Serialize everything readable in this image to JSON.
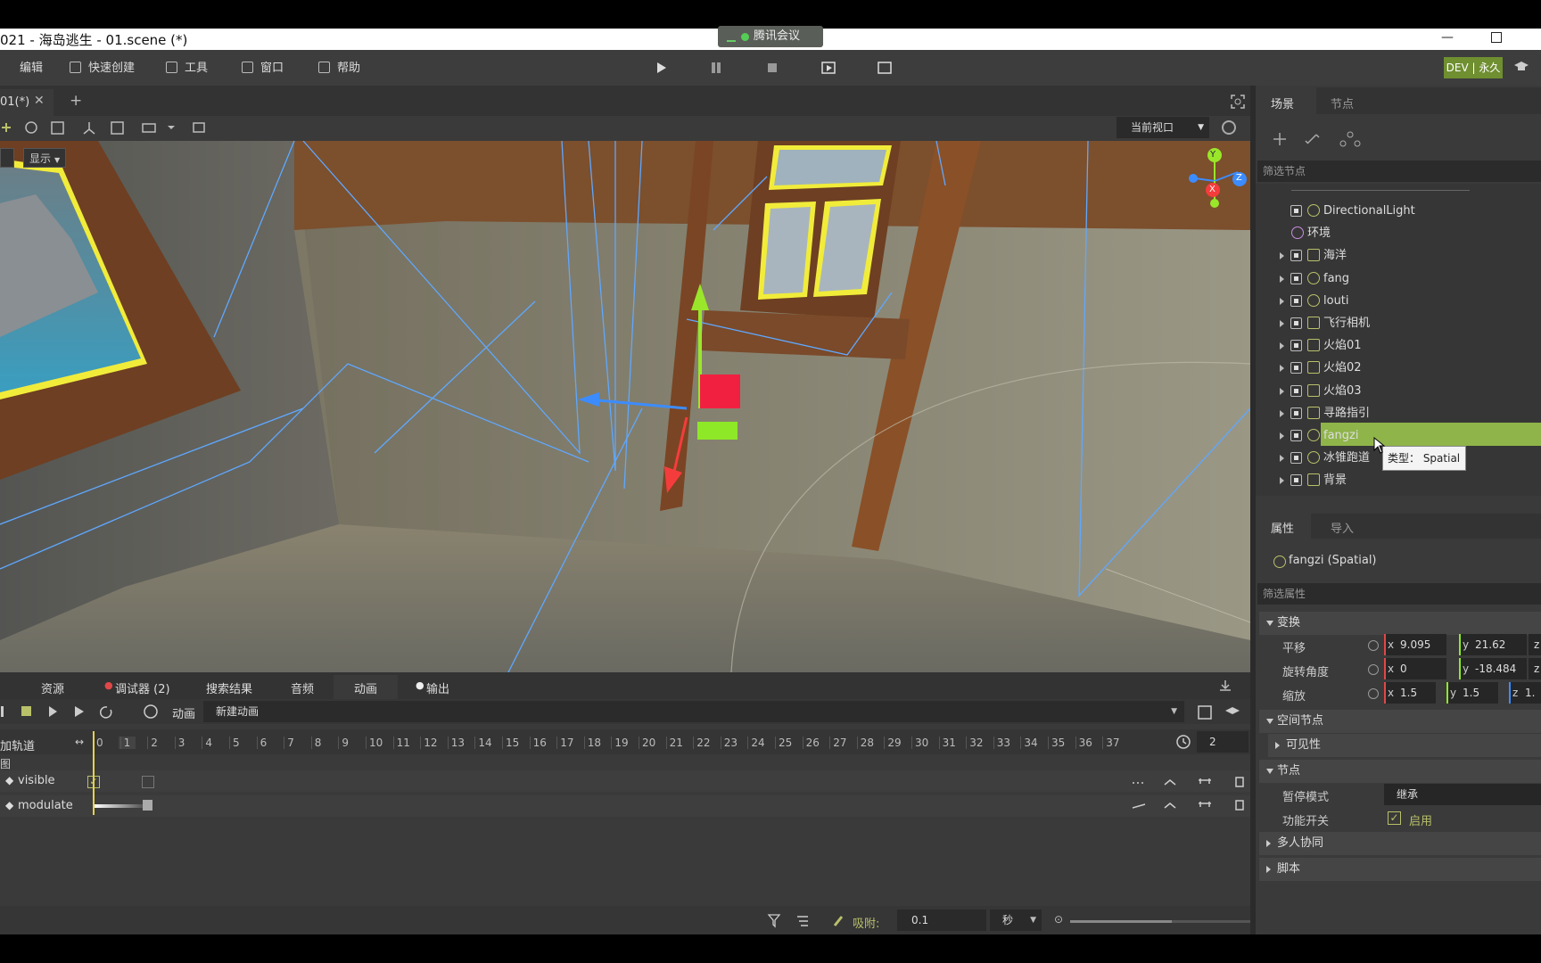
{
  "window": {
    "title": "021 - 海岛逃生 - 01.scene (*)",
    "meeting_label": "腾讯会议",
    "minimize": "—"
  },
  "menu": {
    "items": [
      "编辑",
      "快速创建",
      "工具",
      "窗口",
      "帮助"
    ],
    "badge": "DEV | 永久"
  },
  "editor": {
    "tab": "01(*)",
    "add_tab": "+",
    "show_menu": "显示",
    "viewport_select": "当前视口"
  },
  "gizmo": {
    "y": "Y",
    "x": "X",
    "z": "Z"
  },
  "scene_panel": {
    "tabs": [
      "场景",
      "节点"
    ],
    "filter_placeholder": "筛选节点",
    "nodes": [
      {
        "label": "DirectionalLight",
        "icon": "light-icon"
      },
      {
        "label": "环境",
        "icon": "globe-icon"
      },
      {
        "label": "海洋",
        "icon": "wave-icon"
      },
      {
        "label": "fang",
        "icon": "spatial-icon"
      },
      {
        "label": "louti",
        "icon": "spatial-icon"
      },
      {
        "label": "飞行相机",
        "icon": "camera-icon"
      },
      {
        "label": "火焰01",
        "icon": "sprite-icon"
      },
      {
        "label": "火焰02",
        "icon": "sprite-icon"
      },
      {
        "label": "火焰03",
        "icon": "sprite-icon"
      },
      {
        "label": "寻路指引",
        "icon": "nav-icon"
      },
      {
        "label": "fangzi",
        "icon": "spatial-icon"
      },
      {
        "label": "冰锥跑道",
        "icon": "spatial-icon"
      },
      {
        "label": "背景",
        "icon": "sprite-icon"
      }
    ],
    "selected": "fangzi",
    "tooltip": "类型： Spatial"
  },
  "inspector": {
    "tabs": [
      "属性",
      "导入"
    ],
    "object": "fangzi (Spatial)",
    "filter_placeholder": "筛选属性",
    "transform_section": "变换",
    "translation_label": "平移",
    "translation": {
      "x": "9.095",
      "y": "21.62",
      "z": "z"
    },
    "rotation_label": "旋转角度",
    "rotation": {
      "x": "0",
      "y": "-18.484",
      "z": "z"
    },
    "scale_label": "缩放",
    "scale": {
      "x": "1.5",
      "y": "1.5",
      "z": "1."
    },
    "spatial_section": "空间节点",
    "visibility_section": "可见性",
    "node_section": "节点",
    "pause_mode_label": "暂停模式",
    "pause_mode_value": "继承",
    "process_label": "功能开关",
    "process_value": "启用",
    "multiplayer_section": "多人协同",
    "script_section": "脚本"
  },
  "bottom": {
    "tabs": [
      "资源",
      "调试器 (2)",
      "搜索结果",
      "音频",
      "动画",
      "输出"
    ],
    "anim_label": "动画",
    "anim_name": "新建动画",
    "add_track": "加轨道",
    "ruler": [
      "0",
      "1",
      "2",
      "3",
      "4",
      "5",
      "6",
      "7",
      "8",
      "9",
      "10",
      "11",
      "12",
      "13",
      "14",
      "15",
      "16",
      "17",
      "18",
      "19",
      "20",
      "21",
      "22",
      "23",
      "24",
      "25",
      "26",
      "27",
      "28",
      "29",
      "30",
      "31",
      "32",
      "33",
      "34",
      "35",
      "36",
      "37"
    ],
    "length": "2",
    "group_label": "图",
    "tracks": [
      "visible",
      "modulate"
    ],
    "snap_label": "吸附:",
    "snap_value": "0.1",
    "unit": "秒"
  }
}
